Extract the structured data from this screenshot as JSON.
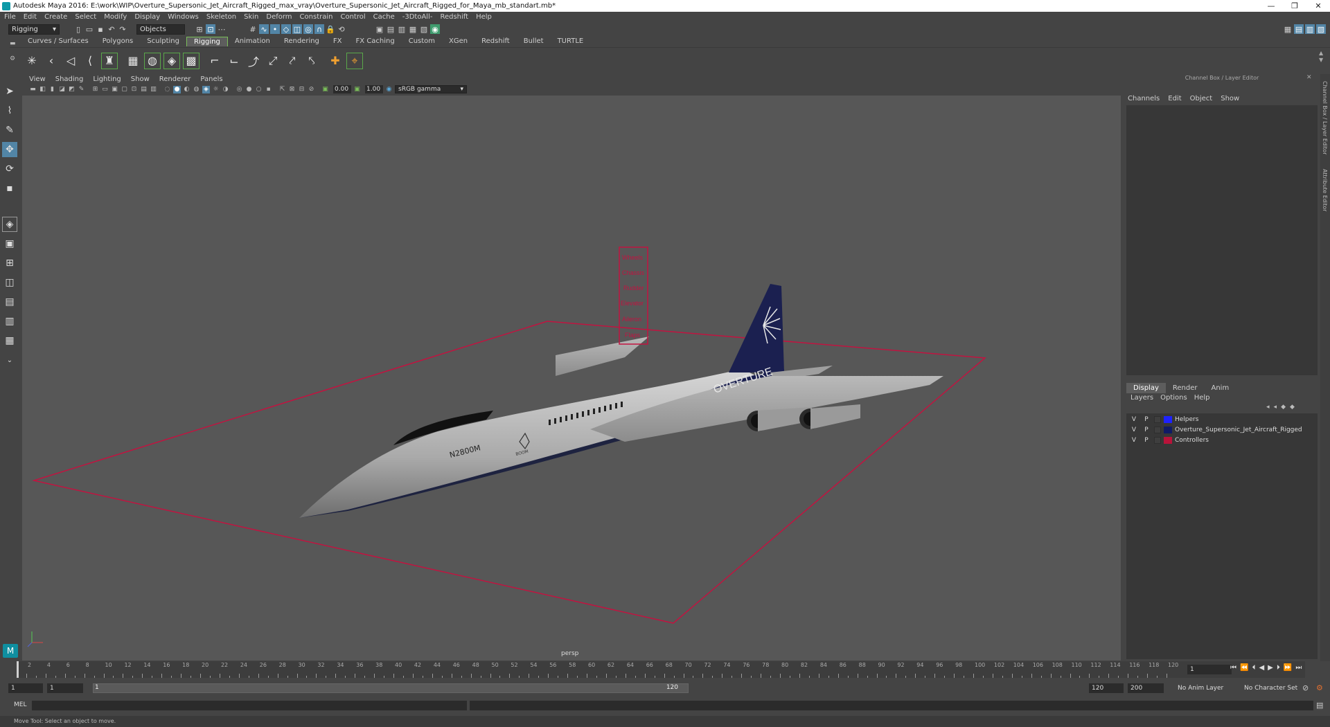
{
  "title_bar": {
    "title": "Autodesk Maya 2016: E:\\work\\WIP\\Overture_Supersonic_Jet_Aircraft_Rigged_max_vray\\Overture_Supersonic_Jet_Aircraft_Rigged_for_Maya_mb_standart.mb*",
    "minimize": "—",
    "restore": "❐",
    "close": "✕"
  },
  "menu": [
    "File",
    "Edit",
    "Create",
    "Select",
    "Modify",
    "Display",
    "Windows",
    "Skeleton",
    "Skin",
    "Deform",
    "Constrain",
    "Control",
    "Cache",
    "-3DtoAll-",
    "Redshift",
    "Help"
  ],
  "status_line": {
    "mode": "Rigging",
    "objects": "Objects"
  },
  "shelf_tabs": [
    "Curves / Surfaces",
    "Polygons",
    "Sculpting",
    "Rigging",
    "Animation",
    "Rendering",
    "FX",
    "FX Caching",
    "Custom",
    "XGen",
    "Redshift",
    "Bullet",
    "TURTLE"
  ],
  "shelf_active": "Rigging",
  "viewport_menu": [
    "View",
    "Shading",
    "Lighting",
    "Show",
    "Renderer",
    "Panels"
  ],
  "viewport_toolbar": {
    "exposure": "0.00",
    "gamma": "1.00",
    "colorspace": "sRGB gamma"
  },
  "viewport": {
    "camera_label": "persp",
    "aircraft_registration": "N2800M",
    "aircraft_brand": "OVERTURE",
    "nose_logo": "BOOM",
    "controllers": [
      "Wheels",
      "Chassis",
      "Rudder",
      "Elevator",
      "Aileron",
      "Flaps"
    ]
  },
  "channel_box": {
    "title": "Channel Box / Layer Editor",
    "menu": [
      "Channels",
      "Edit",
      "Object",
      "Show"
    ]
  },
  "layer_editor": {
    "tabs": [
      "Display",
      "Render",
      "Anim"
    ],
    "active_tab": "Display",
    "menu": [
      "Layers",
      "Options",
      "Help"
    ],
    "layers": [
      {
        "v": "V",
        "p": "P",
        "name": "Helpers",
        "color": "#1e22ff"
      },
      {
        "v": "V",
        "p": "P",
        "name": "Overture_Supersonic_Jet_Aircraft_Rigged",
        "color": "#101a66"
      },
      {
        "v": "V",
        "p": "P",
        "name": "Controllers",
        "color": "#b8133a"
      }
    ]
  },
  "side_tabs": [
    "Channel Box / Layer Editor",
    "Attribute Editor"
  ],
  "time_slider": {
    "current_frame": "1",
    "tick_labels": [
      "2",
      "4",
      "6",
      "8",
      "10",
      "12",
      "14",
      "16",
      "18",
      "20",
      "22",
      "24",
      "26",
      "28",
      "30",
      "32",
      "34",
      "36",
      "38",
      "40",
      "42",
      "44",
      "46",
      "48",
      "50",
      "52",
      "54",
      "56",
      "58",
      "60",
      "62",
      "64",
      "66",
      "68",
      "70",
      "72",
      "74",
      "76",
      "78",
      "80",
      "82",
      "84",
      "86",
      "88",
      "90",
      "92",
      "94",
      "96",
      "98",
      "100",
      "102",
      "104",
      "106",
      "108",
      "110",
      "112",
      "114",
      "116",
      "118",
      "120"
    ]
  },
  "range_slider": {
    "start": "1",
    "playback_start": "1",
    "range_start_label": "1",
    "range_end_label": "120",
    "playback_end": "120",
    "end": "200",
    "anim_layer": "No Anim Layer",
    "character_set": "No Character Set"
  },
  "command_line": {
    "language": "MEL"
  },
  "help_line": "Move Tool: Select an object to move."
}
